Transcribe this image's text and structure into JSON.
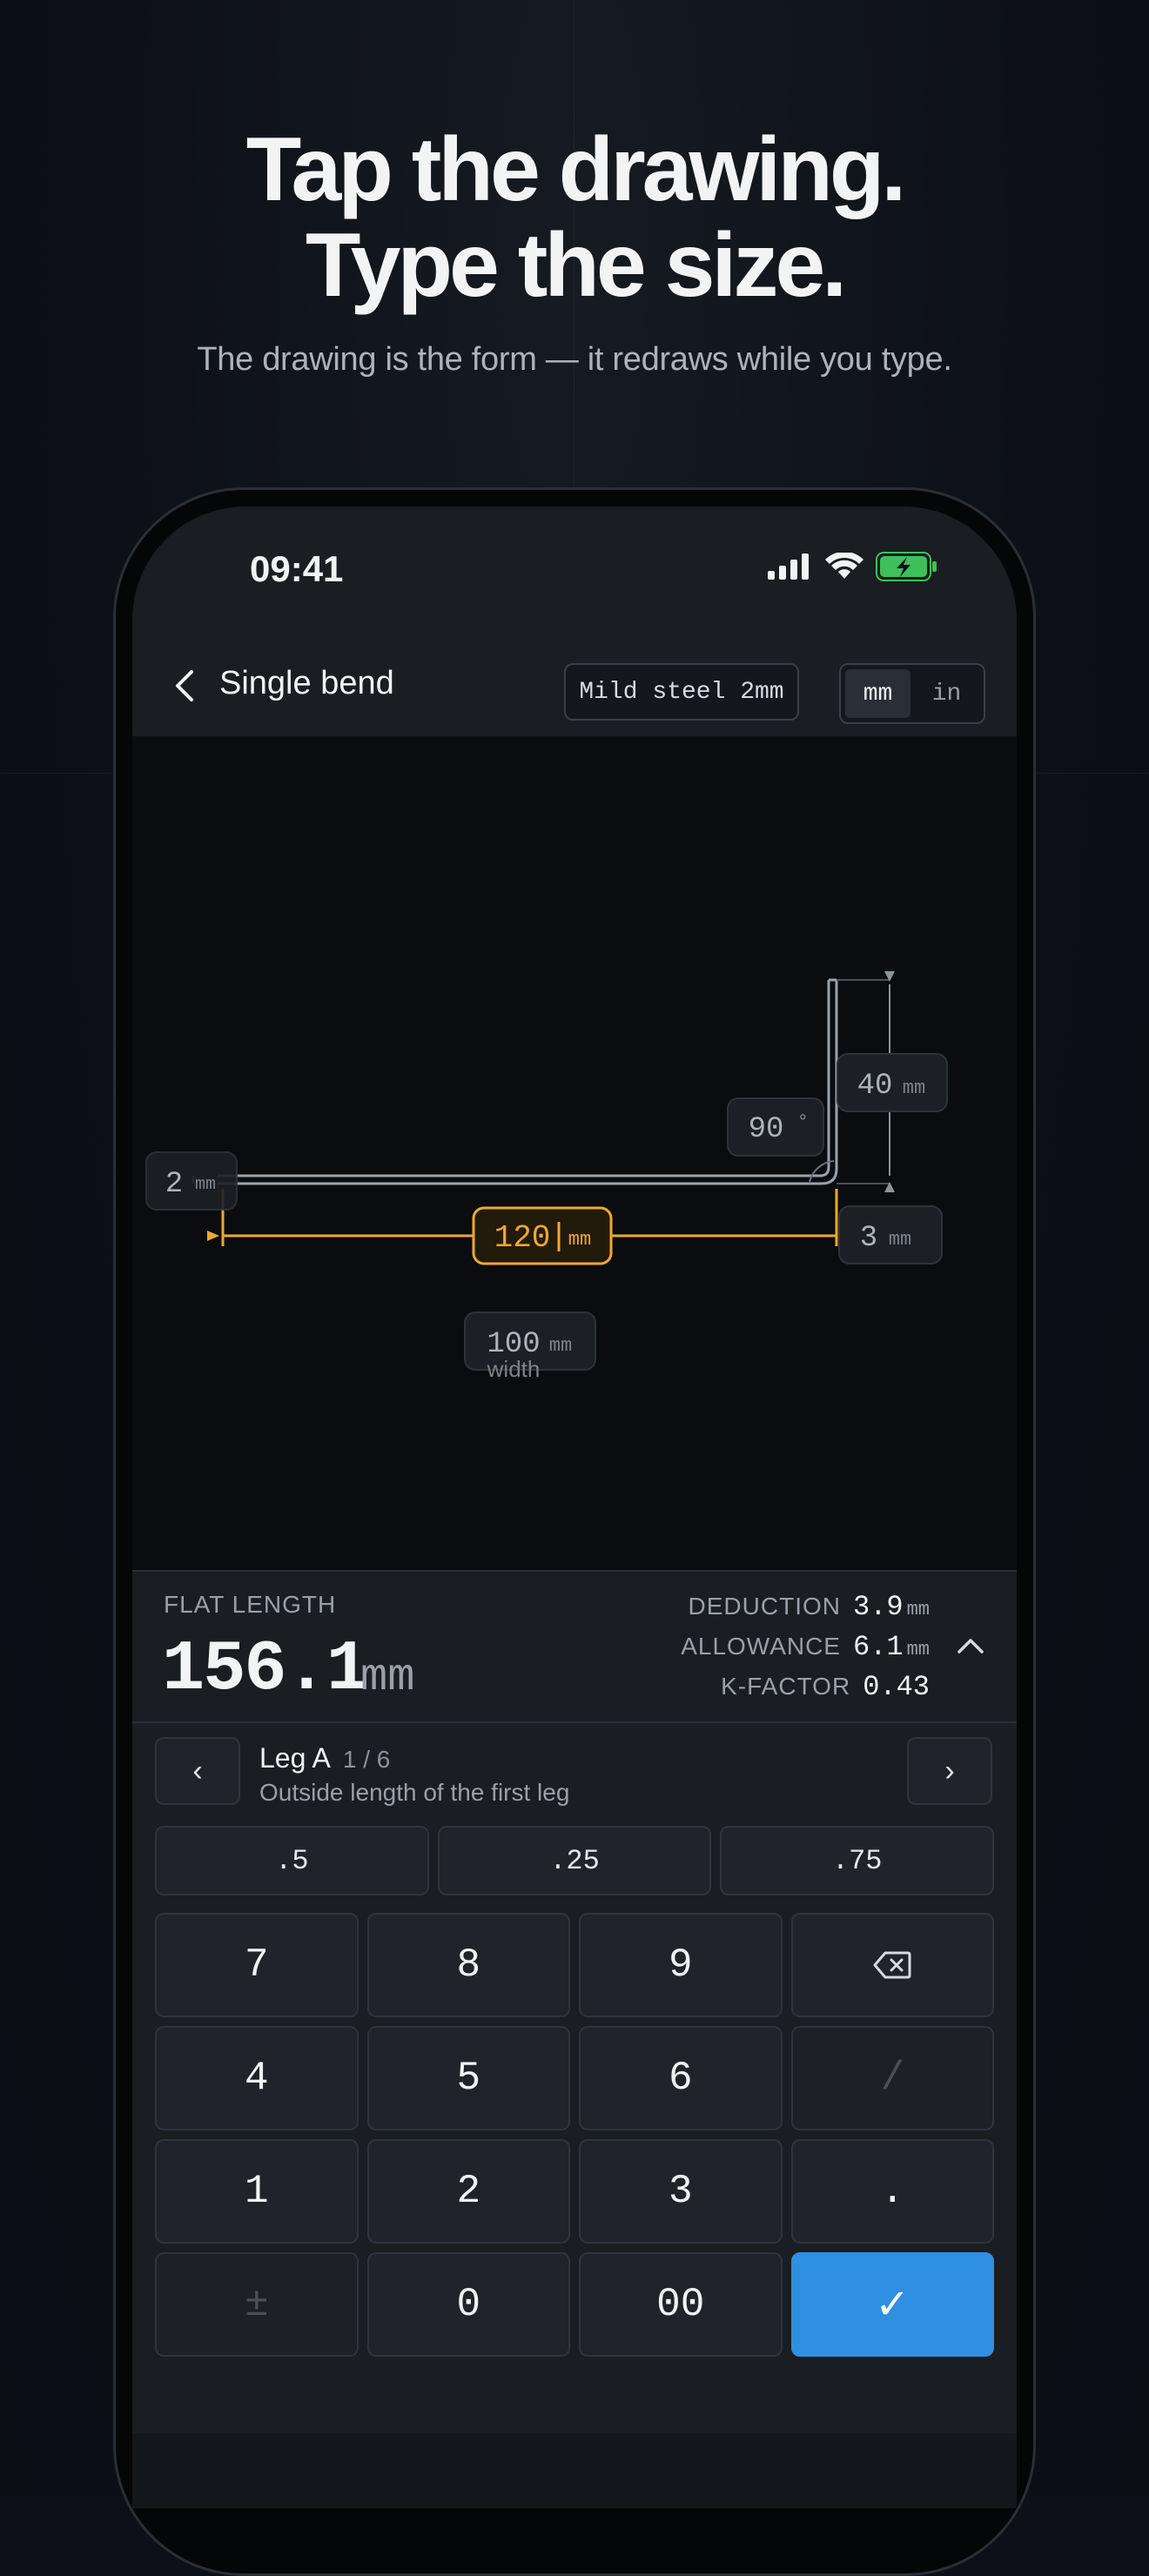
{
  "marketing": {
    "headline_line1": "Tap the drawing.",
    "headline_line2": "Type the size.",
    "subhead": "The drawing is the form — it redraws while you type."
  },
  "status_bar": {
    "time": "09:41",
    "icons": [
      "signal-icon",
      "wifi-icon",
      "battery-charging-icon"
    ],
    "battery_color": "#3fbf5a"
  },
  "nav": {
    "title": "Single bend",
    "material": "Mild steel 2mm",
    "units": [
      "mm",
      "in"
    ],
    "selected_unit": "mm"
  },
  "drawing": {
    "thickness_value": "2",
    "thickness_unit": "mm",
    "leg_a_value": "120",
    "leg_a_unit": "mm",
    "leg_b_value": "40",
    "leg_b_unit": "mm",
    "angle_value": "90",
    "angle_unit": "°",
    "radius_value": "3",
    "radius_unit": "mm",
    "width_value": "100",
    "width_unit": "mm",
    "width_caption": "width",
    "accent_color": "#f0a830"
  },
  "results": {
    "flat_label": "FLAT LENGTH",
    "flat_value": "156.1",
    "flat_unit": "mm",
    "deduction_label": "DEDUCTION",
    "deduction_value": "3.9",
    "deduction_unit": "mm",
    "allowance_label": "ALLOWANCE",
    "allowance_value": "6.1",
    "allowance_unit": "mm",
    "kfactor_label": "K-FACTOR",
    "kfactor_value": "0.43"
  },
  "field": {
    "prev_label": "‹",
    "next_label": "›",
    "name": "Leg A",
    "count": "1 / 6",
    "description": "Outside length of the first leg"
  },
  "fractions": [
    ".5",
    ".25",
    ".75"
  ],
  "keypad": {
    "k7": "7",
    "k8": "8",
    "k9": "9",
    "k4": "4",
    "k5": "5",
    "k6": "6",
    "slash": "/",
    "k1": "1",
    "k2": "2",
    "k3": "3",
    "dot": ".",
    "plusminus": "±",
    "k0": "0",
    "k00": "00",
    "confirm": "✓"
  },
  "colors": {
    "confirm": "#2f8fe0",
    "accent": "#f0a830"
  }
}
